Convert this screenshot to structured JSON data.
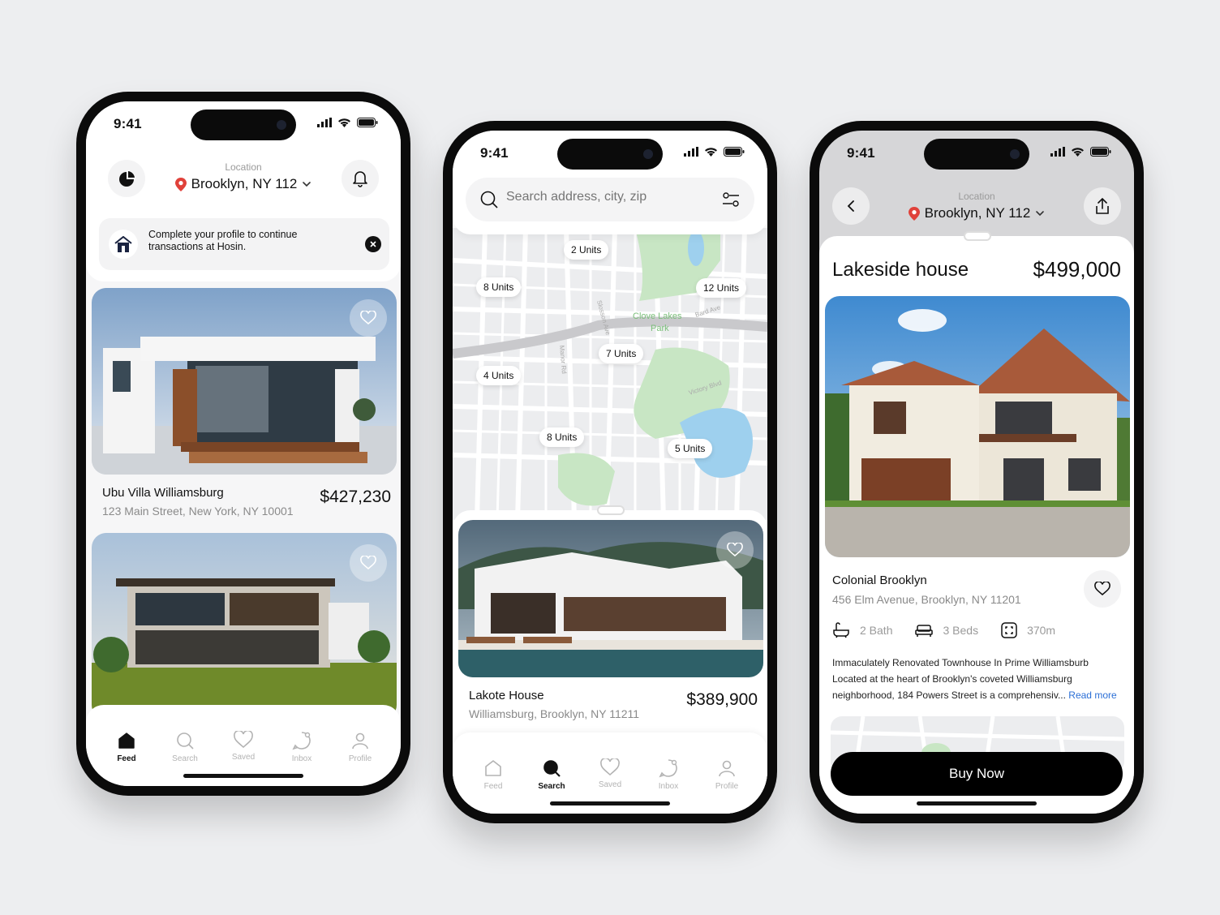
{
  "status": {
    "time": "9:41"
  },
  "feed": {
    "location_label": "Location",
    "location_value": "Brooklyn, NY 112",
    "banner_text_1": "Complete your profile to continue",
    "banner_text_2": "transactions at Hosin.",
    "listings": [
      {
        "title": "Ubu Villa Williamsburg",
        "address": "123 Main Street, New York, NY 10001",
        "price": "$427,230"
      }
    ]
  },
  "search": {
    "placeholder": "Search address, city, zip",
    "map_labels": {
      "park": "Clove Lakes",
      "park2": "Park",
      "street1": "Victory Blvd",
      "street2": "Bard Ave",
      "street3": "Manor Rd",
      "street4": "Slosson Ave"
    },
    "pins": [
      "2 Units",
      "8 Units",
      "12 Units",
      "7 Units",
      "4 Units",
      "8 Units",
      "5 Units"
    ],
    "listing": {
      "title": "Lakote House",
      "address": "Williamsburg, Brooklyn, NY 11211",
      "price": "$389,900"
    }
  },
  "detail": {
    "location_label": "Location",
    "location_value": "Brooklyn, NY 112",
    "name": "Lakeside house",
    "price": "$499,000",
    "subtitle": "Colonial Brooklyn",
    "address": "456 Elm Avenue, Brooklyn, NY 11201",
    "bath": "2 Bath",
    "beds": "3 Beds",
    "area": "370m",
    "desc_1": "Immaculately Renovated Townhouse In Prime Williamsburb",
    "desc_2": "Located at the heart of Brooklyn's coveted Williamsburg",
    "desc_3": "neighborhood, 184 Powers Street is a comprehensiv...",
    "read_more": "Read more",
    "buy": "Buy Now"
  },
  "tabs": [
    "Feed",
    "Search",
    "Saved",
    "Inbox",
    "Profile"
  ],
  "colors": {
    "accent": "#2b6fd6",
    "pin": "#e0413a",
    "dark": "#0b0b0b"
  }
}
